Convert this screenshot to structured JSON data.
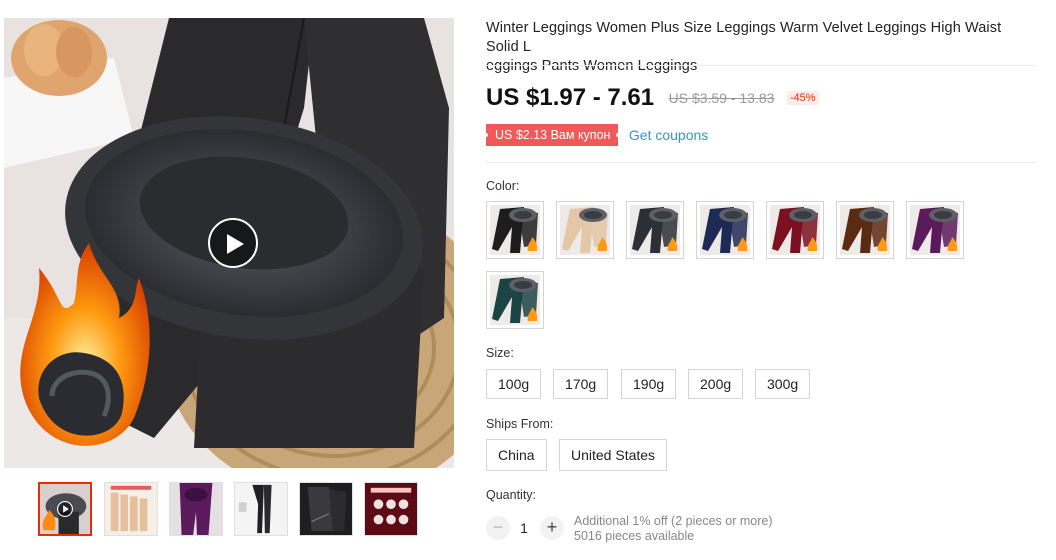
{
  "product": {
    "title": "Winter Leggings Women Plus Size Leggings Warm Velvet Leggings High Waist Solid Leggings Pants Women Leggings",
    "title_line1": "Winter Leggings Women Plus Size Leggings Warm Velvet Leggings High Waist Solid L",
    "title_line2": "eggings Pants Women Leggings"
  },
  "price": {
    "current": "US $1.97 - 7.61",
    "original": "US $3.59 - 13.83",
    "discount": "-45%"
  },
  "coupon": {
    "badge": "US $2.13 Вам купон",
    "link": "Get coupons",
    "badge_color": "#f1585a",
    "link_color": "#3a93c5"
  },
  "color": {
    "label": "Color:",
    "swatches": [
      {
        "name": "black",
        "fabric": "#1d1d1d"
      },
      {
        "name": "skin",
        "fabric": "#e3c7a6"
      },
      {
        "name": "dark-gray",
        "fabric": "#2c2f36"
      },
      {
        "name": "navy",
        "fabric": "#1c2a55"
      },
      {
        "name": "wine-red",
        "fabric": "#7a1020"
      },
      {
        "name": "coffee",
        "fabric": "#5a2a12"
      },
      {
        "name": "purple",
        "fabric": "#5a1a5c"
      },
      {
        "name": "dark-green",
        "fabric": "#1c4444"
      }
    ]
  },
  "size": {
    "label": "Size:",
    "options": [
      "100g",
      "170g",
      "190g",
      "200g",
      "300g"
    ]
  },
  "ships_from": {
    "label": "Ships From:",
    "options": [
      "China",
      "United States"
    ]
  },
  "quantity": {
    "label": "Quantity:",
    "value": "1",
    "minus": "−",
    "plus": "+",
    "note_discount": "Additional 1% off (2 pieces or more)",
    "note_available": "5016 pieces available"
  },
  "gallery": {
    "play_icon": "play-icon",
    "accent": "#e62e04",
    "thumbnails": [
      {
        "name": "thumb-video"
      },
      {
        "name": "thumb-skin-sizes"
      },
      {
        "name": "thumb-purple"
      },
      {
        "name": "thumb-legs-white"
      },
      {
        "name": "thumb-black-detail"
      },
      {
        "name": "thumb-red-promo"
      }
    ]
  }
}
